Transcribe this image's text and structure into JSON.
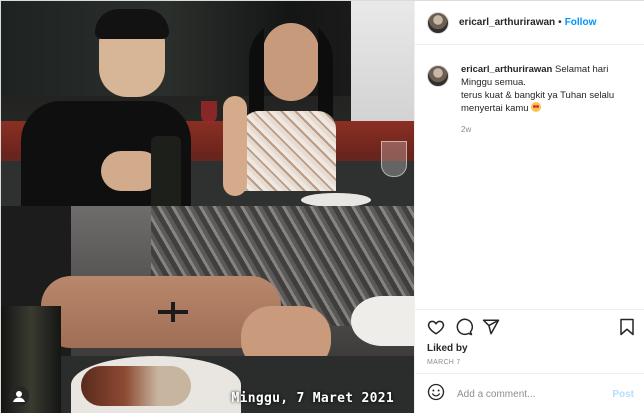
{
  "post": {
    "username": "ericarl_arthurirawan",
    "separator": "•",
    "follow_label": "Follow",
    "caption_lines": [
      "Selamat hari",
      "Minggu semua.",
      "terus kuat & bangkit ya Tuhan selalu",
      "menyertai kamu"
    ],
    "caption_emoji": "smiling-face-with-heart-eyes-icon",
    "time_ago": "2w",
    "likes_label": "Liked by",
    "date": "MARCH 7",
    "photo_text": "Minggu, 7 Maret 2021"
  },
  "comment_box": {
    "placeholder": "Add a comment...",
    "post_label": "Post"
  },
  "icons": {
    "like": "heart-icon",
    "comment": "comment-bubble-icon",
    "share": "paper-plane-icon",
    "save": "bookmark-icon",
    "emoji": "smiley-icon",
    "avatar": "avatar"
  },
  "colors": {
    "accent": "#0095f6",
    "post_disabled": "#b2dffc",
    "text": "#262626",
    "muted": "#8e8e8e",
    "border": "#efefef"
  }
}
